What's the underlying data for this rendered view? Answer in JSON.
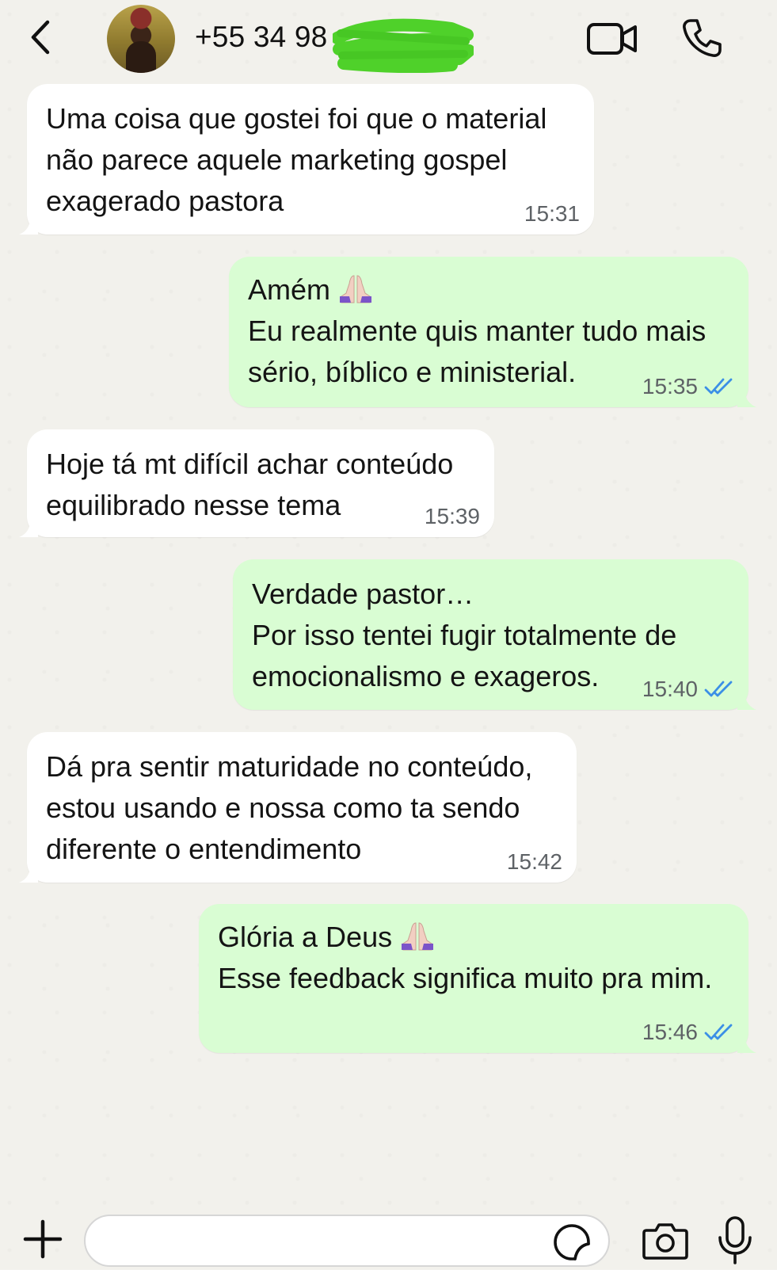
{
  "header": {
    "contact_name": "+55 34 98",
    "icons": [
      "back-arrow-icon",
      "avatar",
      "video-call-icon",
      "phone-call-icon"
    ]
  },
  "messages": [
    {
      "direction": "incoming",
      "text": "Uma coisa que gostei foi que o material\nnão parece aquele marketing gospel\nexagerado pastora",
      "time": "15:31"
    },
    {
      "direction": "outgoing",
      "text_first_line": "Amém",
      "text_rest": "Eu realmente quis manter tudo mais\nsério, bíblico e ministerial.",
      "emoji": "praying-hands-emoji",
      "time": "15:35",
      "status": "read"
    },
    {
      "direction": "incoming",
      "text": "Hoje tá mt difícil achar conteúdo\nequilibrado nesse tema",
      "time": "15:39"
    },
    {
      "direction": "outgoing",
      "text": "Verdade pastor…\nPor isso tentei fugir totalmente de\nemocionalismo e exageros.",
      "time": "15:40",
      "status": "read"
    },
    {
      "direction": "incoming",
      "text": "Dá pra sentir maturidade no conteúdo,\nestou usando e nossa como ta sendo\ndiferente o entendimento",
      "time": "15:42"
    },
    {
      "direction": "outgoing",
      "text_first_line": "Glória a Deus",
      "text_rest": "Esse feedback significa muito pra mim.",
      "emoji": "praying-hands-emoji",
      "time": "15:46",
      "status": "read"
    }
  ],
  "input_bar": {
    "value": "",
    "placeholder": ""
  },
  "colors": {
    "incoming_bubble": "#ffffff",
    "outgoing_bubble": "#d9fdd3",
    "read_ticks": "#3b8fe6",
    "redaction_marker": "#4fd12a"
  }
}
